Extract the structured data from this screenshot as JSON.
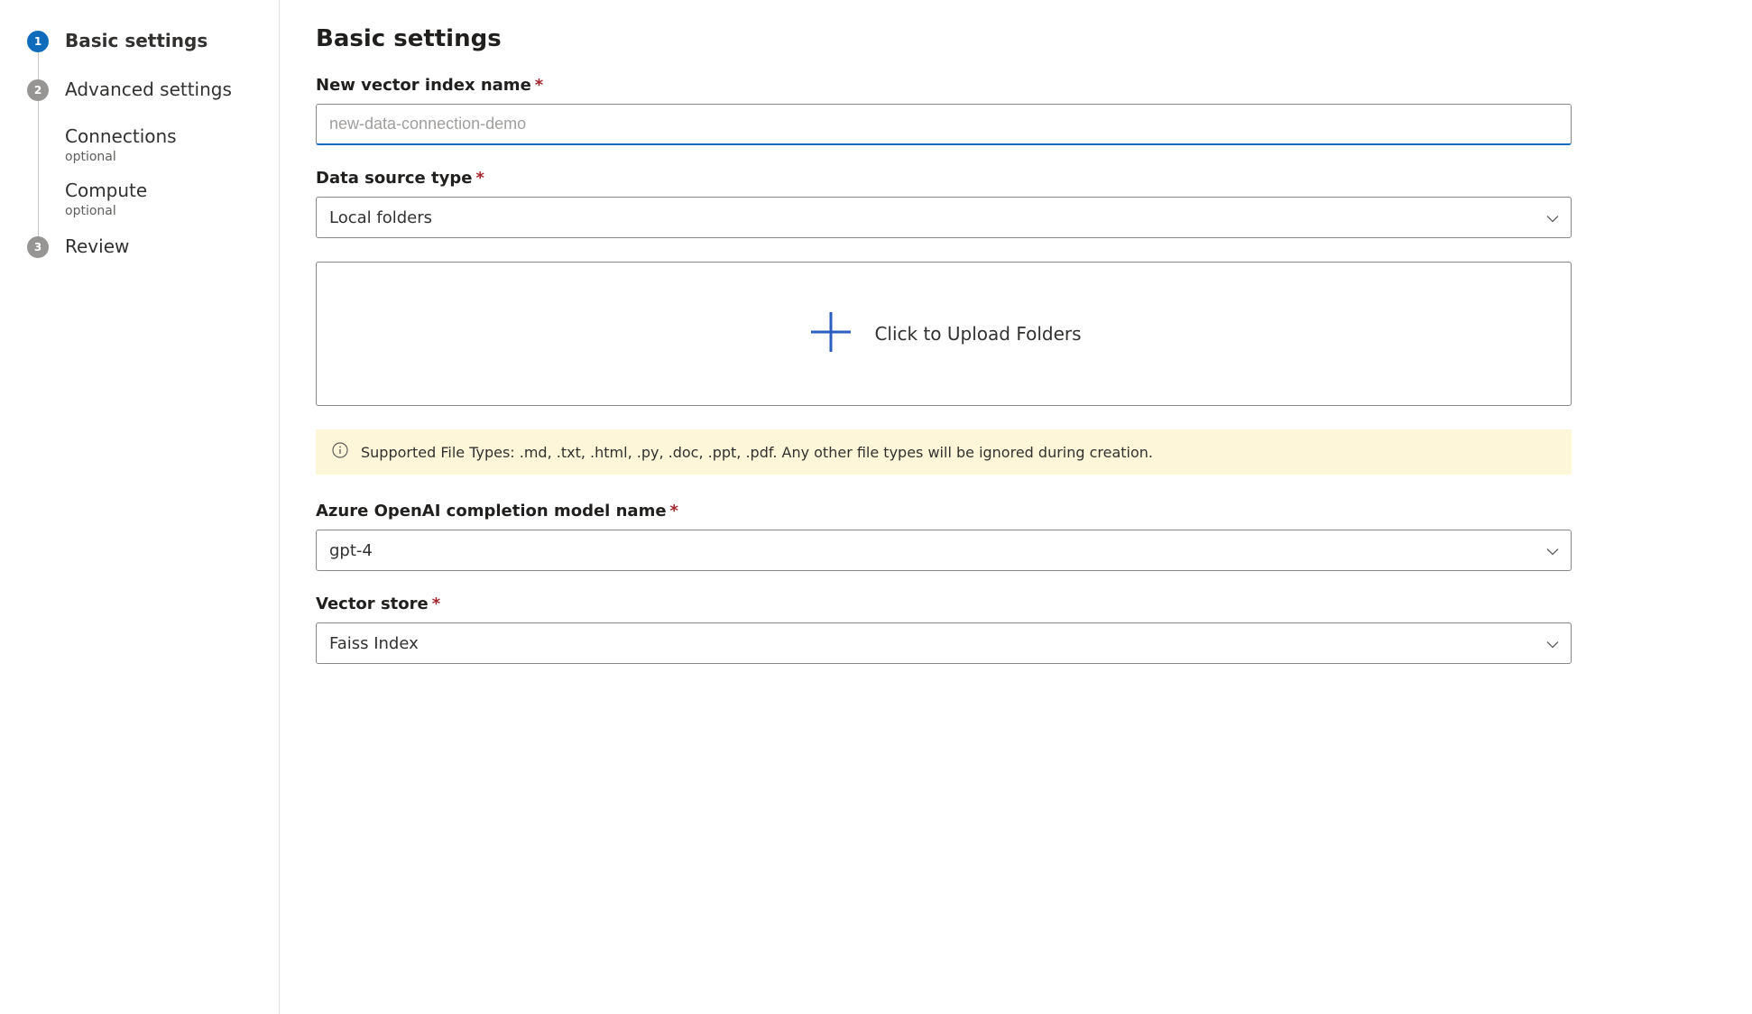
{
  "sidebar": {
    "steps": [
      {
        "num": "1",
        "label": "Basic settings"
      },
      {
        "num": "2",
        "label": "Advanced settings"
      },
      {
        "num": "3",
        "label": "Review"
      }
    ],
    "subSteps": [
      {
        "label": "Connections",
        "tag": "optional"
      },
      {
        "label": "Compute",
        "tag": "optional"
      }
    ]
  },
  "main": {
    "title": "Basic settings",
    "fields": {
      "vectorIndexName": {
        "label": "New vector index name",
        "placeholder": "new-data-connection-demo"
      },
      "dataSourceType": {
        "label": "Data source type",
        "value": "Local folders"
      },
      "uploadZone": {
        "label": "Click to Upload Folders"
      },
      "infoBar": {
        "text": "Supported File Types: .md, .txt, .html, .py, .doc, .ppt, .pdf. Any other file types will be ignored during creation."
      },
      "completionModel": {
        "label": "Azure OpenAI completion model name",
        "value": "gpt-4"
      },
      "vectorStore": {
        "label": "Vector store",
        "value": "Faiss Index"
      }
    }
  }
}
